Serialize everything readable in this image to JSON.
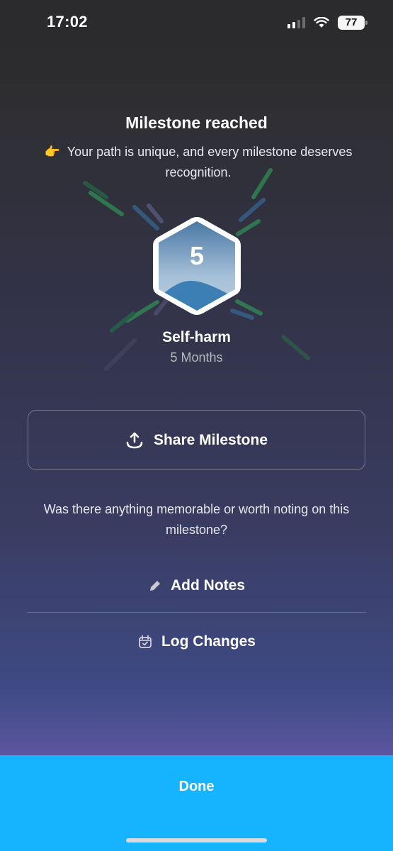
{
  "status_bar": {
    "time": "17:02",
    "battery": "77"
  },
  "milestone": {
    "title": "Milestone reached",
    "emoji": "👉",
    "subtitle": "Your path is unique, and every milestone deserves recognition.",
    "badge_number": "5",
    "name": "Self-harm",
    "duration": "5 Months"
  },
  "actions": {
    "share_label": "Share Milestone",
    "question": "Was there anything memorable or worth noting on this milestone?",
    "add_notes_label": "Add Notes",
    "log_changes_label": "Log Changes",
    "done_label": "Done"
  },
  "colors": {
    "accent": "#16b3ff",
    "badge_border": "#ffffff",
    "badge_fill_top": "#a9c3db",
    "badge_fill_bottom": "#3f7fb3"
  }
}
